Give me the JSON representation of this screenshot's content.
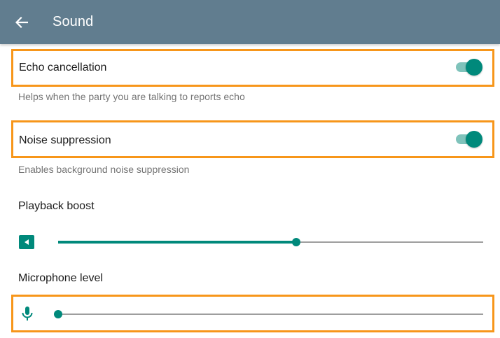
{
  "header": {
    "title": "Sound",
    "back_icon": "arrow-left-icon",
    "background_color": "#617d8f"
  },
  "settings": {
    "echo_cancellation": {
      "label": "Echo cancellation",
      "description": "Helps when the party you are talking to reports echo",
      "enabled": true
    },
    "noise_suppression": {
      "label": "Noise suppression",
      "description": "Enables background noise suppression",
      "enabled": true
    },
    "playback_boost": {
      "label": "Playback boost",
      "icon": "speaker-icon",
      "level_fraction": 0.56
    },
    "microphone_level": {
      "label": "Microphone level",
      "icon": "microphone-icon",
      "level_fraction": 0.0
    }
  },
  "colors": {
    "accent": "#00897b",
    "accent_light": "#7fc3bb",
    "highlight": "#f7961a",
    "rail": "#9e9e9e"
  }
}
